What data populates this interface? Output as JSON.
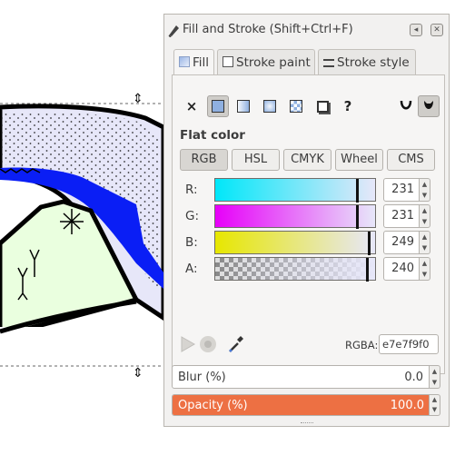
{
  "dialog": {
    "title": "Fill and Stroke (Shift+Ctrl+F)",
    "menu_button": "◂",
    "close_button": "✕"
  },
  "tabs": [
    {
      "label": "Fill",
      "icon": "fill-icon",
      "active": true
    },
    {
      "label": "Stroke paint",
      "icon": "stroke-paint-icon",
      "active": false
    },
    {
      "label": "Stroke style",
      "icon": "stroke-style-icon",
      "active": false
    }
  ],
  "paint_types": {
    "none": "×",
    "flat": "flat-color-icon",
    "linear": "linear-gradient-icon",
    "radial": "radial-gradient-icon",
    "pattern": "pattern-icon",
    "swatch": "swatch-icon",
    "unset": "?",
    "evenodd": "fill-evenodd-icon",
    "nonzero": "fill-nonzero-icon"
  },
  "fill": {
    "type_label": "Flat color",
    "modes": [
      "RGB",
      "HSL",
      "CMYK",
      "Wheel",
      "CMS"
    ],
    "active_mode": "RGB",
    "channels": [
      {
        "label": "R:",
        "value": "231"
      },
      {
        "label": "G:",
        "value": "231"
      },
      {
        "label": "B:",
        "value": "249"
      },
      {
        "label": "A:",
        "value": "240"
      }
    ],
    "rgba_label": "RGBA:",
    "rgba_value": "e7e7f9f0",
    "color": "#e7e7f9"
  },
  "blur": {
    "label": "Blur (%)",
    "value": "0.0"
  },
  "opacity": {
    "label": "Opacity (%)",
    "value": "100.0",
    "fraction": 1.0
  },
  "colors": {
    "accent": "#ed7043",
    "canvas_fill": "#e7e7f9",
    "stroke_blue": "#0a1ef5",
    "green_fill": "#eaffdf"
  }
}
